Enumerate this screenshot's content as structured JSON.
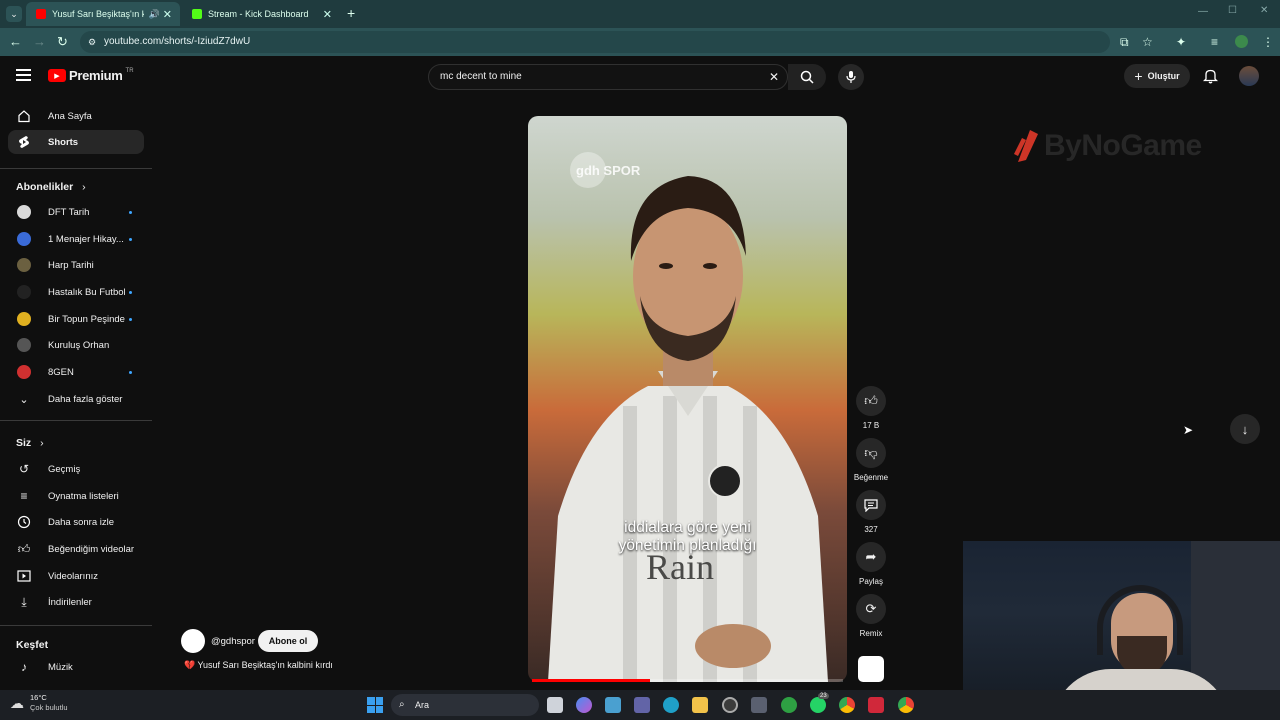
{
  "browser": {
    "tabs": [
      {
        "label": "Yusuf Sarı Beşiktaş'ın kal...",
        "active": true
      },
      {
        "label": "Stream - Kick Dashboard",
        "active": false
      }
    ],
    "url": "youtube.com/shorts/-IziudZ7dwU"
  },
  "header": {
    "logo_text": "Premium",
    "region": "TR",
    "search_value": "mc decent to mine",
    "create_label": "Oluştur"
  },
  "sidebar": {
    "main": [
      {
        "label": "Ana Sayfa",
        "icon": "home-icon"
      },
      {
        "label": "Shorts",
        "icon": "shorts-icon",
        "active": true
      }
    ],
    "subs_heading": "Abonelikler",
    "subscriptions": [
      {
        "label": "DFT Tarih",
        "new": true,
        "color": "#d9d9d9"
      },
      {
        "label": "1 Menajer Hikay...",
        "new": true,
        "color": "#3a6bd8"
      },
      {
        "label": "Harp Tarihi",
        "new": false,
        "color": "#6b6040"
      },
      {
        "label": "Hastalık Bu Futbol",
        "new": true,
        "color": "#222222"
      },
      {
        "label": "Bir Topun Peşinde",
        "new": true,
        "color": "#e0b020"
      },
      {
        "label": "Kuruluş Orhan",
        "new": false,
        "color": "#555555"
      },
      {
        "label": "8GEN",
        "new": true,
        "color": "#d03030"
      }
    ],
    "show_more": "Daha fazla göster",
    "you_heading": "Siz",
    "you_items": [
      {
        "label": "Geçmiş",
        "icon": "history-icon"
      },
      {
        "label": "Oynatma listeleri",
        "icon": "playlists-icon"
      },
      {
        "label": "Daha sonra izle",
        "icon": "clock-icon"
      },
      {
        "label": "Beğendiğim videolar",
        "icon": "thumbs-up-icon"
      },
      {
        "label": "Videolarınız",
        "icon": "video-icon"
      },
      {
        "label": "İndirilenler",
        "icon": "download-icon"
      }
    ],
    "explore_heading": "Keşfet",
    "explore_items": [
      {
        "label": "Müzik",
        "icon": "music-icon"
      }
    ]
  },
  "short": {
    "watermark": "gdh SPOR",
    "caption_line1": "iddialara göre yeni",
    "caption_line2": "yönetimin planladığı",
    "shirt_text": "Rain",
    "channel": "@gdhspor",
    "subscribe_label": "Abone ol",
    "title": "💔 Yusuf Sarı Beşiktaş'ın kalbini kırdı",
    "progress": 0.38
  },
  "actions": {
    "likes": "17 B",
    "dislike_label": "Beğenme",
    "comments": "327",
    "share_label": "Paylaş",
    "remix_label": "Remix"
  },
  "overlay": {
    "brand": "ByNoGame"
  },
  "taskbar": {
    "weather_temp": "16°C",
    "weather_desc": "Çok bulutlu",
    "search_label": "Ara",
    "badge": "23"
  }
}
